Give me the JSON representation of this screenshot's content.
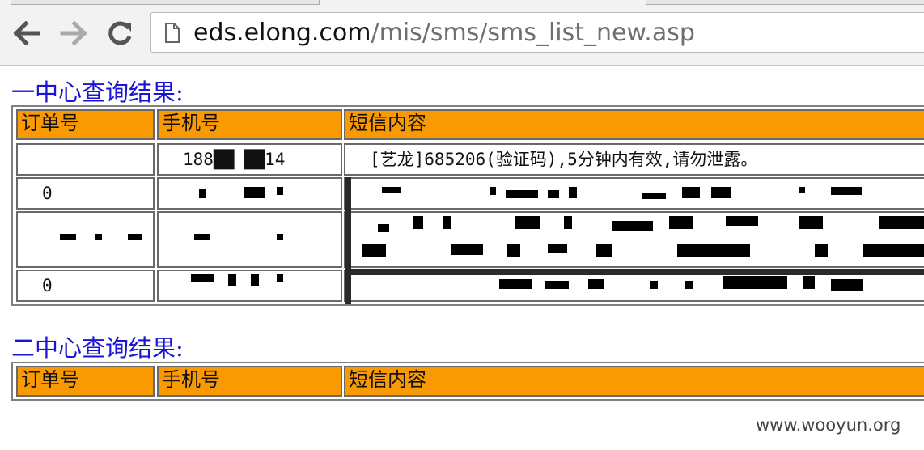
{
  "browser": {
    "url_host": "eds.elong.com",
    "url_path": "/mis/sms/sms_list_new.asp",
    "back_icon": "arrow-left-icon",
    "forward_icon": "arrow-right-icon",
    "reload_icon": "reload-icon",
    "page_icon": "document-icon"
  },
  "sections": [
    {
      "title": "一中心查询结果:",
      "headers": [
        "订单号",
        "手机号",
        "短信内容"
      ],
      "rows": [
        {
          "order": "",
          "phone": "188██ ██14",
          "sms": "[艺龙]685206(验证码),5分钟内有效,请勿泄露。"
        },
        {
          "order": "0",
          "phone": "",
          "sms": ""
        },
        {
          "order": "",
          "phone": "",
          "sms": ""
        },
        {
          "order": "0",
          "phone": "",
          "sms": ""
        }
      ]
    },
    {
      "title": "二中心查询结果:",
      "headers": [
        "订单号",
        "手机号",
        "短信内容"
      ],
      "rows": []
    }
  ],
  "watermark": "www.wooyun.org",
  "colors": {
    "header_bg": "#f99a02",
    "title_blue": "#1a14d6"
  }
}
